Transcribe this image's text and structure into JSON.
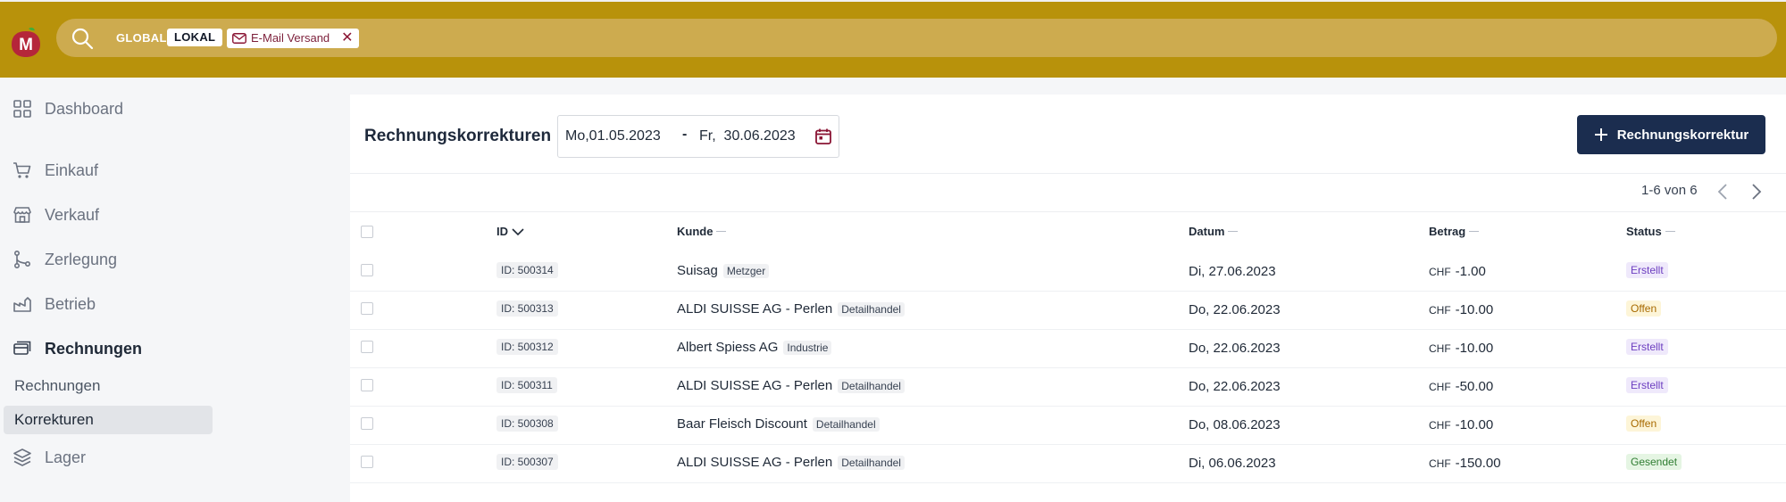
{
  "search": {
    "scope_global": "GLOBAL",
    "scope_lokal": "LOKAL",
    "filter_chip": "E-Mail Versand",
    "chip_close": "✕"
  },
  "sidebar": {
    "items": [
      {
        "label": "Dashboard",
        "icon": "grid-icon"
      },
      {
        "label": "Einkauf",
        "icon": "cart-icon"
      },
      {
        "label": "Verkauf",
        "icon": "store-icon"
      },
      {
        "label": "Zerlegung",
        "icon": "branch-icon"
      },
      {
        "label": "Betrieb",
        "icon": "factory-icon"
      },
      {
        "label": "Rechnungen",
        "icon": "invoice-icon"
      },
      {
        "label": "Lager",
        "icon": "layers-icon"
      }
    ],
    "subitems": [
      "Rechnungen",
      "Korrekturen"
    ],
    "selected_subitem": "Korrekturen"
  },
  "main": {
    "title": "Rechnungskorrekturen",
    "date_from": "Mo,01.05.2023",
    "date_dash": "-",
    "date_to": "Fr,  30.06.2023",
    "add_button": "Rechnungskorrektur",
    "pager": "1-6 von 6",
    "columns": [
      "ID",
      "Kunde",
      "Datum",
      "Betrag",
      "Status"
    ],
    "currency": "CHF",
    "rows": [
      {
        "id": "ID: 500314",
        "kunde": "Suisag",
        "tag": "Metzger",
        "datum": "Di, 27.06.2023",
        "betrag": "-1.00",
        "status": "Erstellt"
      },
      {
        "id": "ID: 500313",
        "kunde": "ALDI SUISSE AG - Perlen",
        "tag": "Detailhandel",
        "datum": "Do, 22.06.2023",
        "betrag": "-10.00",
        "status": "Offen"
      },
      {
        "id": "ID: 500312",
        "kunde": "Albert Spiess AG",
        "tag": "Industrie",
        "datum": "Do, 22.06.2023",
        "betrag": "-10.00",
        "status": "Erstellt"
      },
      {
        "id": "ID: 500311",
        "kunde": "ALDI SUISSE AG - Perlen",
        "tag": "Detailhandel",
        "datum": "Do, 22.06.2023",
        "betrag": "-50.00",
        "status": "Erstellt"
      },
      {
        "id": "ID: 500308",
        "kunde": "Baar Fleisch Discount",
        "tag": "Detailhandel",
        "datum": "Do, 08.06.2023",
        "betrag": "-10.00",
        "status": "Offen"
      },
      {
        "id": "ID: 500307",
        "kunde": "ALDI SUISSE AG - Perlen",
        "tag": "Detailhandel",
        "datum": "Di, 06.06.2023",
        "betrag": "-150.00",
        "status": "Gesendet"
      }
    ]
  },
  "colors": {
    "header_bg": "#b8920b",
    "search_bg": "#cdab4f",
    "primary_button": "#1b2d4f",
    "status_erstellt_bg": "#efe9fb",
    "status_erstellt_fg": "#6d3fc0",
    "status_offen_bg": "#fdf5d8",
    "status_offen_fg": "#a86a00",
    "status_gesendet_bg": "#e5f5e3",
    "status_gesendet_fg": "#2f7d32",
    "accent": "#8a1534"
  }
}
